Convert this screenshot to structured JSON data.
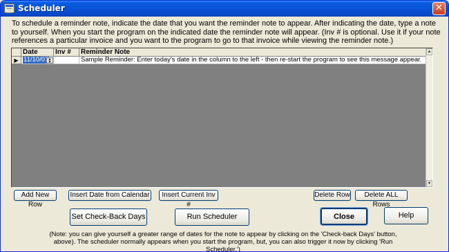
{
  "window": {
    "title": "Scheduler",
    "close_glyph": "✕"
  },
  "instructions": "To schedule a reminder note, indicate the date that you want the reminder note to appear.  After indicating the date, type a note to yourself.  When you start the program on the indicated date the reminder note will appear.  (Inv # is optional.  Use it if your note references a particular invoice and you want to the program to go to that invoice while viewing the reminder note.)",
  "grid": {
    "columns": [
      "Date",
      "Inv #",
      "Reminder Note"
    ],
    "rows": [
      {
        "date": "11/10/07",
        "inv": "",
        "note": "Sample Reminder: Enter today's date in the column to the left - then re-start the program to see this message appear."
      }
    ],
    "row_indicator": "▶"
  },
  "buttons": {
    "add_new_row": "Add New Row",
    "insert_date": "Insert Date from Calendar",
    "insert_inv": "Insert Current Inv #",
    "delete_row": "Delete Row",
    "delete_all": "Delete ALL Rows",
    "set_checkback": "Set Check-Back Days",
    "run_scheduler": "Run Scheduler",
    "close": "Close",
    "help": "Help"
  },
  "note": "(Note: you can give yourself a greater range of dates for the note to appear by clicking on the 'Check-back Days' button, above).  The scheduler normally appears when you start the program, but, you can also trigger it  now by clicking 'Run Scheduler.')",
  "icons": {
    "app": "scheduler-window-icon",
    "close": "close-icon",
    "scroll_up": "scroll-up-arrow-icon",
    "scroll_down": "scroll-down-arrow-icon",
    "spin": "spinner-icon"
  }
}
